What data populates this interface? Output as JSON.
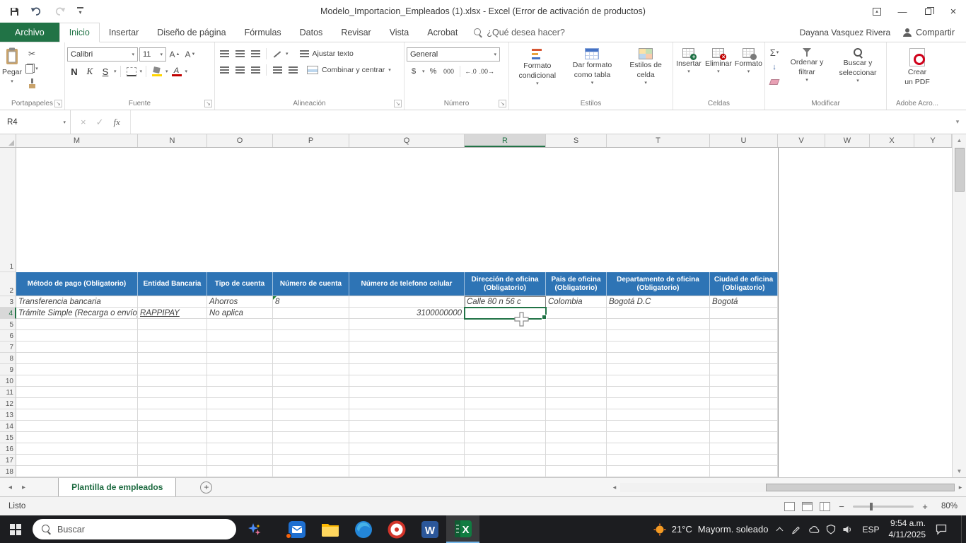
{
  "colors": {
    "excel_green": "#217346",
    "header_blue": "#2E74B5",
    "taskbar_bg": "#1C1D20"
  },
  "titlebar": {
    "title": "Modelo_Importacion_Empleados (1).xlsx - Excel (Error de activación de productos)"
  },
  "menu": {
    "file": "Archivo",
    "tabs": [
      "Inicio",
      "Insertar",
      "Diseño de página",
      "Fórmulas",
      "Datos",
      "Revisar",
      "Vista",
      "Acrobat"
    ],
    "active_tab": "Inicio",
    "tell_me": "¿Qué desea hacer?",
    "user_name": "Dayana Vasquez Rivera",
    "share": "Compartir"
  },
  "ribbon": {
    "paste": "Pegar",
    "groups": {
      "clipboard": "Portapapeles",
      "font": "Fuente",
      "alignment": "Alineación",
      "number": "Número",
      "styles": "Estilos",
      "cells": "Celdas",
      "editing": "Modificar",
      "adobe": "Adobe Acro..."
    },
    "font_name": "Calibri",
    "font_size": "11",
    "bold": "N",
    "italic": "K",
    "underline": "S",
    "wrap_text": "Ajustar texto",
    "merge_center": "Combinar y centrar",
    "number_format": "General",
    "currency": "$",
    "percent": "%",
    "thousands": "000",
    "inc_decimal": "←.0",
    "dec_decimal": ".00→",
    "cond_format_1": "Formato",
    "cond_format_2": "condicional",
    "format_table_1": "Dar formato",
    "format_table_2": "como tabla",
    "cell_styles_1": "Estilos de",
    "cell_styles_2": "celda",
    "insert": "Insertar",
    "delete": "Eliminar",
    "format": "Formato",
    "autosum": "Σ",
    "sort_1": "Ordenar y",
    "sort_2": "filtrar",
    "find_1": "Buscar y",
    "find_2": "seleccionar",
    "create_pdf_1": "Crear",
    "create_pdf_2": "un PDF"
  },
  "formula_bar": {
    "name_box": "R4",
    "formula": ""
  },
  "grid": {
    "columns": [
      "M",
      "N",
      "O",
      "P",
      "Q",
      "R",
      "S",
      "T",
      "U",
      "V",
      "W",
      "X",
      "Y"
    ],
    "selected_column": "R",
    "selected_row": 4,
    "rows_visible": 18,
    "header_fill": "#2E74B5",
    "headers": {
      "M": "Método de pago (Obligatorio)",
      "N": "Entidad Bancaria",
      "O": "Tipo de cuenta",
      "P": "Número de cuenta",
      "Q": "Número de telefono celular",
      "R": "Dirección de oficina (Obligatorio)",
      "S": "Pais de oficina (Obligatorio)",
      "T": "Departamento de oficina (Obligatorio)",
      "U": "Ciudad de oficina (Obligatorio)"
    },
    "cells": [
      {
        "row": 3,
        "col": "M",
        "text": "Transferencia bancaria",
        "style": "italic"
      },
      {
        "row": 3,
        "col": "O",
        "text": "Ahorros",
        "style": "italic"
      },
      {
        "row": 3,
        "col": "P",
        "text": "8",
        "style": "italic",
        "error_indicator": true
      },
      {
        "row": 3,
        "col": "R",
        "text": "Calle 80 n 56 c",
        "style": "italic",
        "outlined": true
      },
      {
        "row": 3,
        "col": "S",
        "text": "Colombia",
        "style": "italic"
      },
      {
        "row": 3,
        "col": "T",
        "text": "Bogotá D.C",
        "style": "italic"
      },
      {
        "row": 3,
        "col": "U",
        "text": "Bogotá",
        "style": "italic"
      },
      {
        "row": 4,
        "col": "M",
        "text": "Trámite Simple (Recarga o envío)",
        "style": "italic"
      },
      {
        "row": 4,
        "col": "N",
        "text": "RAPPIPAY",
        "style": "italic underline"
      },
      {
        "row": 4,
        "col": "O",
        "text": "No aplica",
        "style": "italic"
      },
      {
        "row": 4,
        "col": "Q",
        "text": "3100000000",
        "style": "italic",
        "align": "right"
      }
    ]
  },
  "sheet_tabs": {
    "active_tab": "Plantilla de empleados"
  },
  "status_bar": {
    "mode": "Listo",
    "zoom": "80%"
  },
  "taskbar": {
    "search_placeholder": "Buscar",
    "temperature": "21°C",
    "weather": "Mayorm. soleado",
    "language": "ESP",
    "time": "9:54 a.m.",
    "date": "4/11/2025"
  }
}
